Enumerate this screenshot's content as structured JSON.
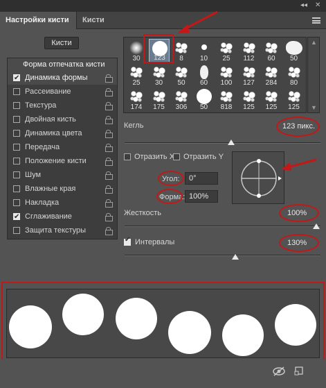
{
  "panel": {
    "tabs": [
      {
        "label": "Настройки кисти",
        "active": true
      },
      {
        "label": "Кисти",
        "active": false
      }
    ],
    "collapse_glyph": "◂◂",
    "close_glyph": "✕",
    "brushes_button": "Кисти"
  },
  "left_list": {
    "header": "Форма отпечатка кисти",
    "items": [
      {
        "label": "Динамика формы",
        "checked": true,
        "highlighted": true
      },
      {
        "label": "Рассеивание",
        "checked": false
      },
      {
        "label": "Текстура",
        "checked": false
      },
      {
        "label": "Двойная кисть",
        "checked": false
      },
      {
        "label": "Динамика цвета",
        "checked": false
      },
      {
        "label": "Передача",
        "checked": false
      },
      {
        "label": "Положение кисти",
        "checked": false
      },
      {
        "label": "Шум",
        "checked": false
      },
      {
        "label": "Влажные края",
        "checked": false
      },
      {
        "label": "Накладка",
        "checked": false
      },
      {
        "label": "Сглаживание",
        "checked": true
      },
      {
        "label": "Защита текстуры",
        "checked": false
      }
    ]
  },
  "brush_grid": {
    "rows": [
      [
        "30",
        "123",
        "8",
        "10",
        "25",
        "112",
        "60",
        "50"
      ],
      [
        "25",
        "30",
        "50",
        "60",
        "100",
        "127",
        "284",
        "80"
      ],
      [
        "174",
        "175",
        "306",
        "50",
        "818",
        "125",
        "125",
        "125"
      ]
    ],
    "selected": "123"
  },
  "controls": {
    "size_label": "Кегль",
    "size_value": "123 пикс.",
    "flip_x": "Отразить X",
    "flip_y": "Отразить Y",
    "angle_label": "Угол:",
    "angle_value": "0°",
    "roundness_label": "Форма:",
    "roundness_value": "100%",
    "hardness_label": "Жесткость",
    "hardness_value": "100%",
    "spacing_label": "Интервалы",
    "spacing_value": "130%",
    "spacing_checked": true
  },
  "colors": {
    "annotation_red": "#c21818",
    "selected_cell": "#6b7c8e",
    "panel_bg": "#535353"
  }
}
